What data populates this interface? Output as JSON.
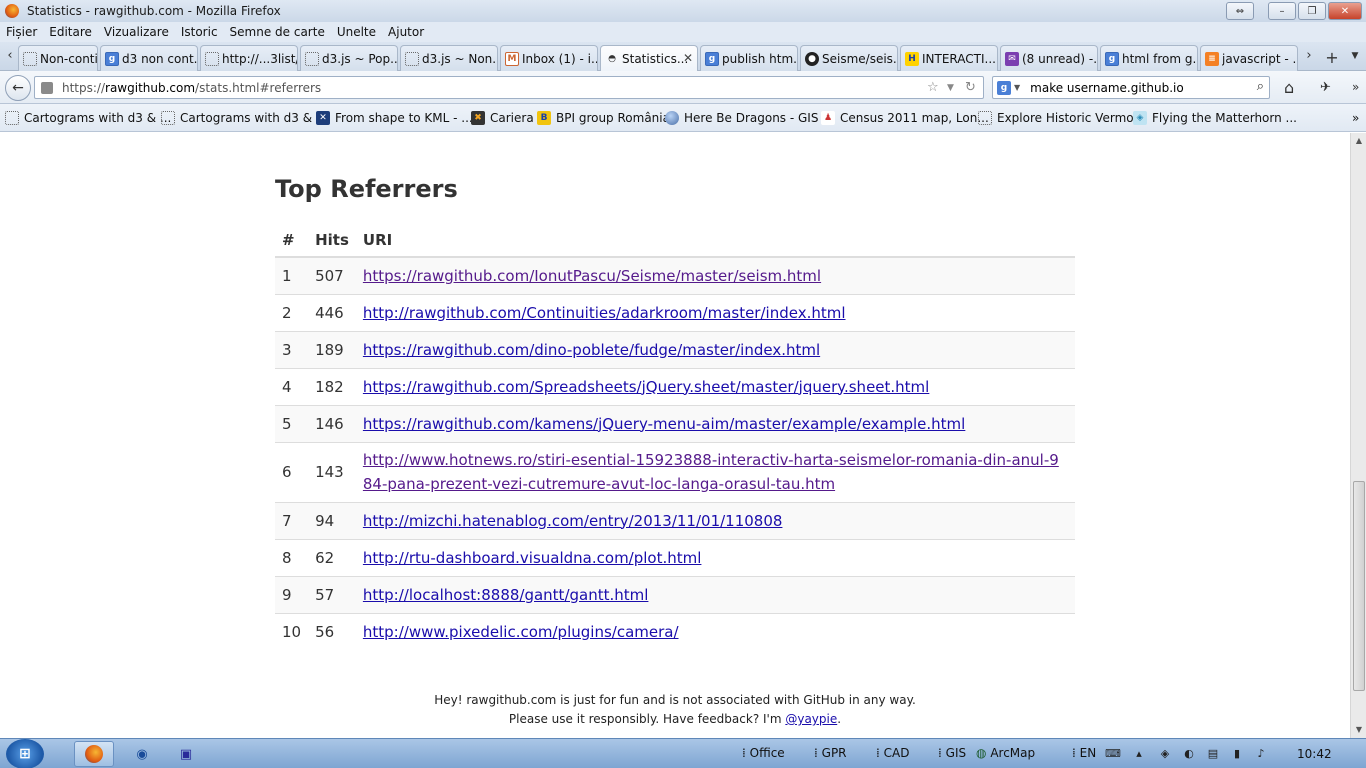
{
  "window": {
    "title": "Statistics - rawgithub.com - Mozilla Firefox",
    "controls": [
      "⇔",
      "–",
      "❐",
      "✕"
    ]
  },
  "menu": [
    "Fișier",
    "Editare",
    "Vizualizare",
    "Istoric",
    "Semne de carte",
    "Unelte",
    "Ajutor"
  ],
  "tabs": [
    {
      "label": "Non-contig...",
      "icon": "blank"
    },
    {
      "label": "d3 non cont...",
      "icon": "google"
    },
    {
      "label": "http://...3list/",
      "icon": "blank"
    },
    {
      "label": "d3.js ~ Pop...",
      "icon": "blank"
    },
    {
      "label": "d3.js ~ Non...",
      "icon": "blank"
    },
    {
      "label": "Inbox (1) - i...",
      "icon": "gmail"
    },
    {
      "label": "Statistics...",
      "icon": "rawgithub",
      "active": true
    },
    {
      "label": "publish htm...",
      "icon": "google"
    },
    {
      "label": "Seisme/seis...",
      "icon": "github"
    },
    {
      "label": "INTERACTI...",
      "icon": "hotnews"
    },
    {
      "label": "(8 unread) -...",
      "icon": "yahoo"
    },
    {
      "label": "html from g...",
      "icon": "google"
    },
    {
      "label": "javascript - ...",
      "icon": "stackoverflow"
    }
  ],
  "nav": {
    "url_prefix": "https://",
    "url_host": "rawgithub.com",
    "url_path": "/stats.html#referrers",
    "search_value": "make username.github.io"
  },
  "bookmarks": [
    {
      "label": "Cartograms with d3 & ...",
      "icon": "blank"
    },
    {
      "label": "Cartograms with d3 & ...",
      "icon": "blank"
    },
    {
      "label": "From shape to KML - ...",
      "icon": "x"
    },
    {
      "label": "Cariera",
      "icon": "cariera"
    },
    {
      "label": "BPI group România",
      "icon": "bpi"
    },
    {
      "label": "Here Be Dragons - GIS ...",
      "icon": "globe"
    },
    {
      "label": "Census 2011 map, Lon...",
      "icon": "census"
    },
    {
      "label": "Explore Historic Vermo...",
      "icon": "blank"
    },
    {
      "label": "Flying the Matterhorn ...",
      "icon": "flying"
    }
  ],
  "page": {
    "title": "Top Referrers",
    "columns": [
      "#",
      "Hits",
      "URI"
    ],
    "rows": [
      {
        "n": "1",
        "hits": "507",
        "uri": "https://rawgithub.com/IonutPascu/Seisme/master/seism.html",
        "visited": true
      },
      {
        "n": "2",
        "hits": "446",
        "uri": "http://rawgithub.com/Continuities/adarkroom/master/index.html",
        "visited": false
      },
      {
        "n": "3",
        "hits": "189",
        "uri": "https://rawgithub.com/dino-poblete/fudge/master/index.html",
        "visited": false
      },
      {
        "n": "4",
        "hits": "182",
        "uri": "https://rawgithub.com/Spreadsheets/jQuery.sheet/master/jquery.sheet.html",
        "visited": false
      },
      {
        "n": "5",
        "hits": "146",
        "uri": "https://rawgithub.com/kamens/jQuery-menu-aim/master/example/example.html",
        "visited": false
      },
      {
        "n": "6",
        "hits": "143",
        "uri": "http://www.hotnews.ro/stiri-esential-15923888-interactiv-harta-seismelor-romania-din-anul-984-pana-prezent-vezi-cutremure-avut-loc-langa-orasul-tau.htm",
        "visited": true
      },
      {
        "n": "7",
        "hits": "94",
        "uri": "http://mizchi.hatenablog.com/entry/2013/11/01/110808",
        "visited": false
      },
      {
        "n": "8",
        "hits": "62",
        "uri": "http://rtu-dashboard.visualdna.com/plot.html",
        "visited": false
      },
      {
        "n": "9",
        "hits": "57",
        "uri": "http://localhost:8888/gantt/gantt.html",
        "visited": false
      },
      {
        "n": "10",
        "hits": "56",
        "uri": "http://www.pixedelic.com/plugins/camera/",
        "visited": false
      }
    ],
    "footer_text_1": "Hey! rawgithub.com is just for fun and is not associated with GitHub in any way. Please use it responsibly. Have feedback? I'm ",
    "footer_link": "@yaypie",
    "footer_end": "."
  },
  "taskbar": {
    "groups": [
      "Office",
      "GPR",
      "CAD",
      "GIS",
      "ArcMap"
    ],
    "lang": "EN",
    "clock": "10:42"
  },
  "colors": {
    "link": "#1a0dab",
    "visited": "#551a8b",
    "stripe": "#f9f9f9"
  }
}
